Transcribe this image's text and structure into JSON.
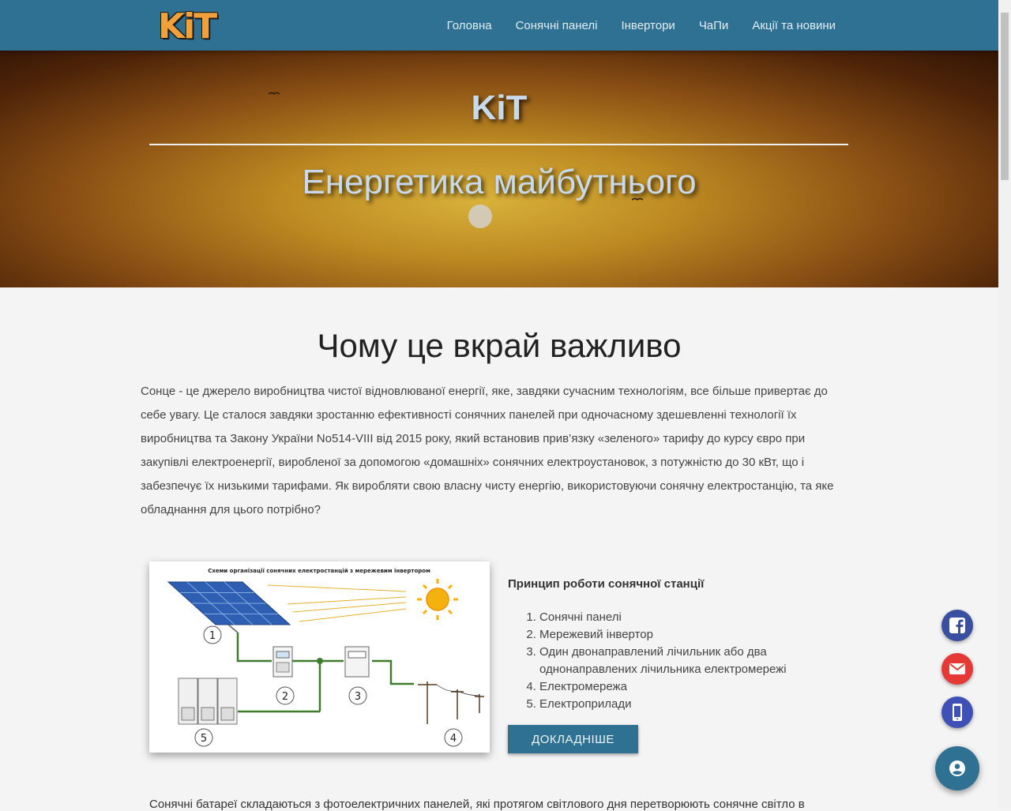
{
  "navbar": {
    "logo_text": "KiT",
    "links": [
      "Головна",
      "Сонячні панелі",
      "Інвертори",
      "ЧаПи",
      "Акції та новини"
    ]
  },
  "hero": {
    "title": "KiT",
    "subtitle": "Енергетика майбутнього"
  },
  "main": {
    "heading": "Чому це вкрай важливо",
    "intro": "Сонце - це джерело виробництва чистої відновлюваної енергії, яке, завдяки сучасним технологіям, все більше привертає до себе увагу. Це сталося завдяки зростанню ефективності сонячних панелей при одночасному здешевленні технології їх виробництва та Закону України No514-VIII від 2015 року, який встановив прив’язку «зеленого» тарифу до курсу євро при закупівлі електроенергії, виробленої за допомогою «домашніх» сонячних електроустановок, з потужністю до 30 кВт, що і забезпечує їх низькими тарифами. Як виробляти свою власну чисту енергію, використовуючи сонячну електростанцію, та яке обладнання для цього потрібно?",
    "diagram": {
      "title": "Схеми організації сонячних електростанцій з мережевим інвертором",
      "labels": [
        "1",
        "2",
        "3",
        "4",
        "5"
      ]
    },
    "principle_title": "Принцип роботи сонячної станції",
    "steps": [
      "Сонячні панелі",
      "Мережевий інвертор",
      "Один двонаправлений лічильник або два однонаправлених лічильника електромережі",
      "Електромережа",
      "Електроприлади"
    ],
    "more_button": "ДОКЛАДНІШЕ",
    "bottom_text": "Сонячні батареї складаються з фотоелектричних панелей, які протягом світлового дня перетворюють сонячне світло в"
  },
  "colors": {
    "navbar": "#2e7193",
    "facebook": "#3b4fa0",
    "mail": "#e53935",
    "phone": "#3f51b5",
    "contact": "#2e7193"
  },
  "icons": [
    "facebook-icon",
    "mail-icon",
    "phone-icon",
    "account-icon"
  ]
}
